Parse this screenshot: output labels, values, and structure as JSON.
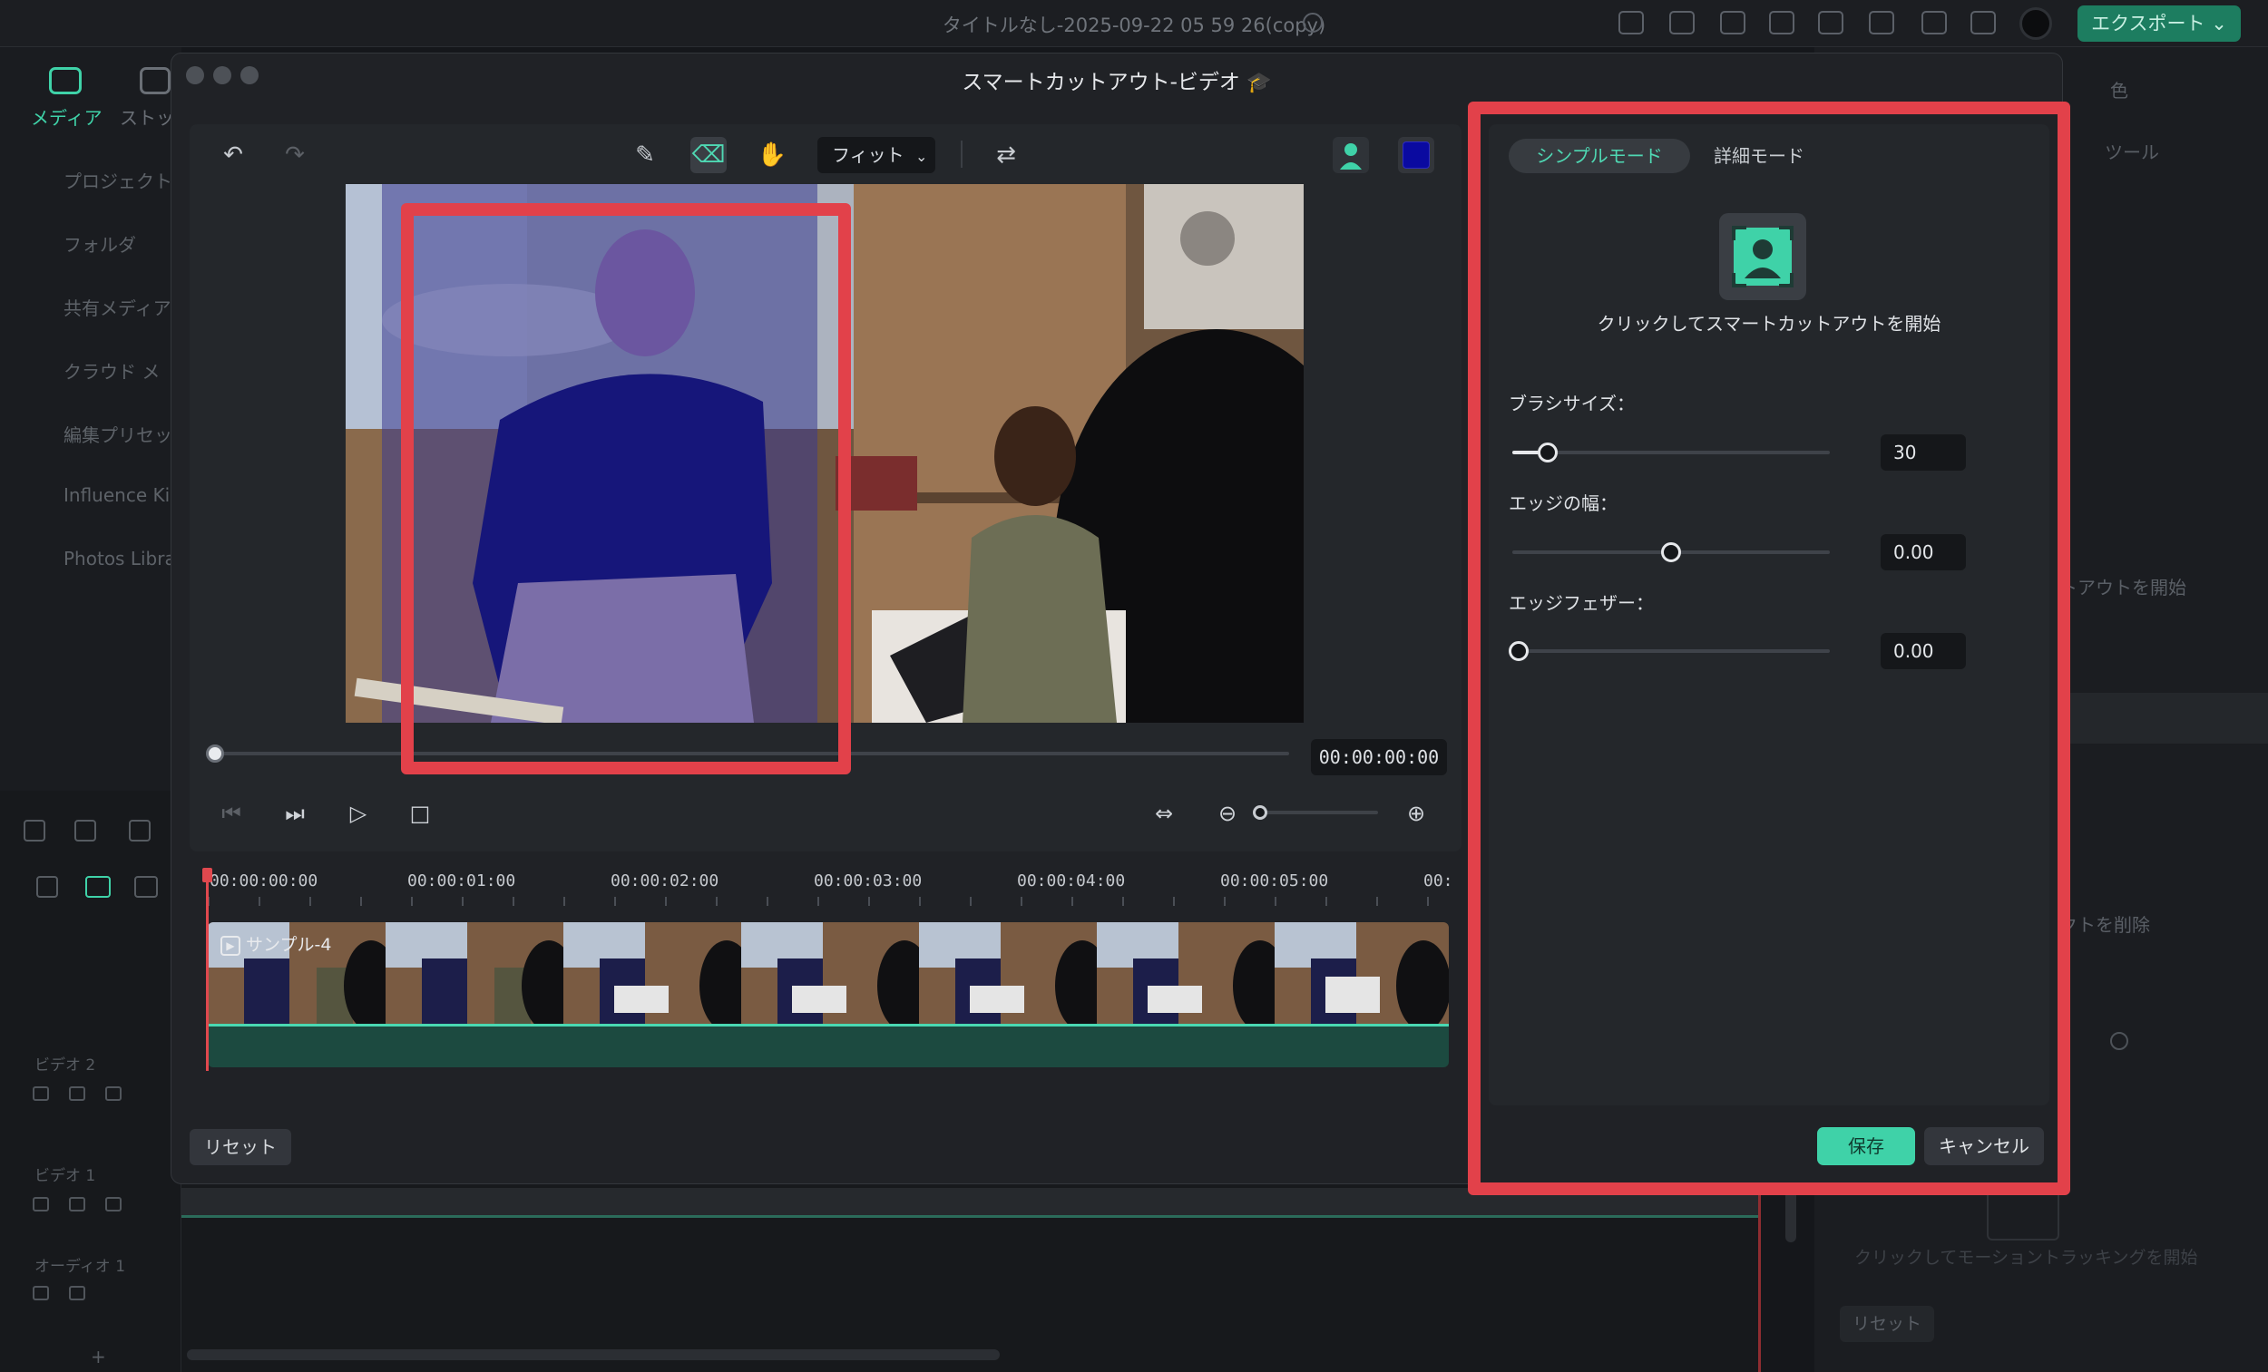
{
  "app": {
    "title": "タイトルなし-2025-09-22 05 59 26(copy)",
    "export_label": "エクスポート"
  },
  "left_sidebar": {
    "tab_media": "メディア",
    "tab_stock": "ストッ",
    "items": [
      "プロジェクト",
      "フォルダ",
      "共有メディア",
      "クラウド メ",
      "編集プリセッ",
      "Influence Ki",
      "Photos Libra"
    ]
  },
  "tracks": {
    "video2": "ビデオ 2",
    "video1": "ビデオ 1",
    "audio1": "オーディオ 1"
  },
  "right_panel_bg": {
    "color_tab": "色",
    "tools_label": "ツール",
    "cutout_start": "トアウトを開始",
    "object_delete": "クトを削除",
    "motion_tracking": "クリックしてモーショントラッキングを開始",
    "reset": "リセット"
  },
  "modal": {
    "title": "スマートカットアウト-ビデオ",
    "fit_label": "フィット",
    "timecode": "00:00:00:00",
    "clip_name": "サンプル-4",
    "ruler_labels": [
      "00:00:00:00",
      "00:00:01:00",
      "00:00:02:00",
      "00:00:03:00",
      "00:00:04:00",
      "00:00:05:00",
      "00:"
    ],
    "reset_label": "リセット",
    "brand_color": "#3fd2a8",
    "mask_color": "#0a0aa0"
  },
  "settings": {
    "tab_simple": "シンプルモード",
    "tab_detail": "詳細モード",
    "start_label": "クリックしてスマートカットアウトを開始",
    "brush_size_label": "ブラシサイズ：",
    "brush_size_value": "30",
    "edge_width_label": "エッジの幅：",
    "edge_width_value": "0.00",
    "edge_feather_label": "エッジフェザー：",
    "edge_feather_value": "0.00",
    "save_label": "保存",
    "cancel_label": "キャンセル"
  }
}
